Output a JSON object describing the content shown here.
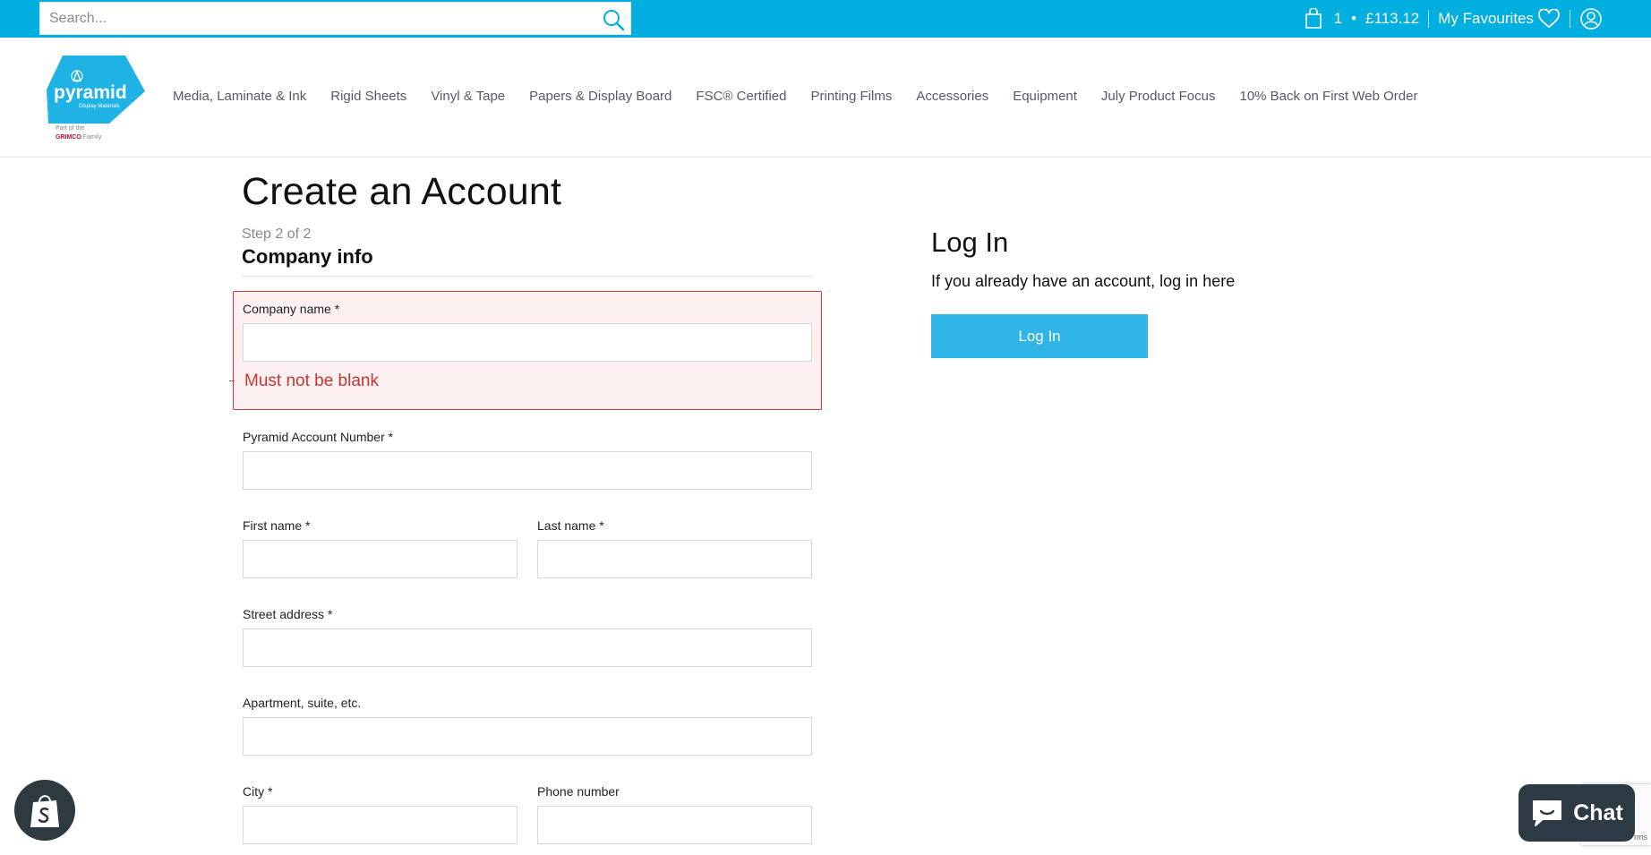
{
  "topbar": {
    "search_placeholder": "Search...",
    "cart_count": "1",
    "cart_separator": "•",
    "cart_total": "£113.12",
    "favourites_label": "My Favourites",
    "bar_color": "#00aee0"
  },
  "logo": {
    "name": "pyramid",
    "subtitle": "Display Materials",
    "tag_prefix": "Part of the",
    "tag_brand": "GRIMCO",
    "tag_suffix": "Family"
  },
  "nav": {
    "items": [
      "Media, Laminate & Ink",
      "Rigid Sheets",
      "Vinyl & Tape",
      "Papers & Display Board",
      "FSC® Certified",
      "Printing Films",
      "Accessories",
      "Equipment",
      "July Product Focus",
      "10% Back on First Web Order"
    ]
  },
  "form": {
    "page_title": "Create an Account",
    "step": "Step 2 of 2",
    "section_title": "Company info",
    "company_name_label": "Company name *",
    "company_name_error": "Must not be blank",
    "account_number_label": "Pyramid Account Number *",
    "first_name_label": "First name *",
    "last_name_label": "Last name *",
    "street_label": "Street address *",
    "apartment_label": "Apartment, suite, etc.",
    "city_label": "City *",
    "phone_label": "Phone number"
  },
  "login": {
    "title": "Log In",
    "text": "If you already have an account, log in here",
    "button_label": "Log In",
    "button_color": "#2fb5e6"
  },
  "chat": {
    "label": "Chat"
  },
  "recaptcha": {
    "text": "rms"
  },
  "icons": {
    "search": "search-icon",
    "cart": "shopping-bag-icon",
    "heart": "heart-icon",
    "account": "account-icon",
    "shopify": "shopify-bag-icon",
    "chat": "chat-bubble-icon"
  }
}
